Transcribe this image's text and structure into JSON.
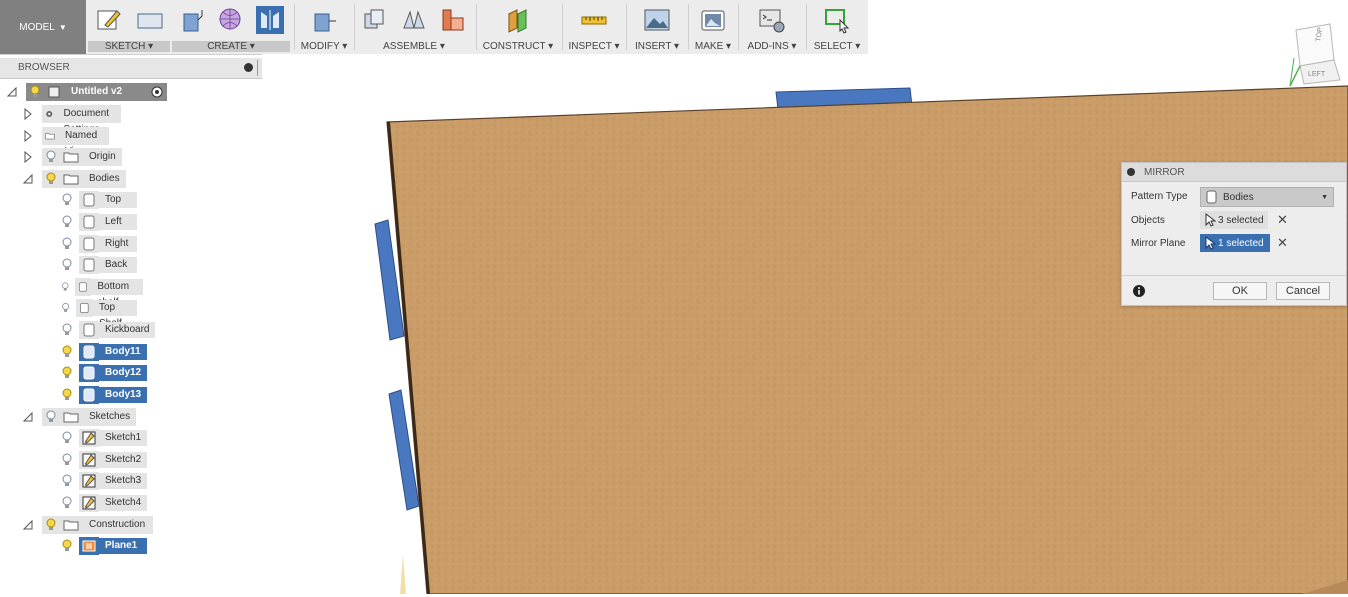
{
  "toolbar": {
    "model_label": "MODEL",
    "groups": {
      "sketch": "SKETCH ▾",
      "create": "CREATE ▾",
      "modify": "MODIFY ▾",
      "assemble": "ASSEMBLE ▾",
      "construct": "CONSTRUCT ▾",
      "inspect": "INSPECT ▾",
      "insert": "INSERT ▾",
      "make": "MAKE ▾",
      "addins": "ADD-INS ▾",
      "select": "SELECT ▾"
    }
  },
  "browser": {
    "title": "BROWSER",
    "root": "Untitled v2",
    "document_settings": "Document Settings",
    "named_views": "Named Views",
    "origin": "Origin",
    "bodies": "Bodies",
    "body_items": [
      "Top",
      "Left",
      "Right",
      "Back",
      "Bottom shelf",
      "Top Shelf",
      "Kickboard",
      "Body11",
      "Body12",
      "Body13"
    ],
    "sketches": "Sketches",
    "sketch_items": [
      "Sketch1",
      "Sketch2",
      "Sketch3",
      "Sketch4"
    ],
    "construction": "Construction",
    "plane": "Plane1"
  },
  "mirror": {
    "title": "MIRROR",
    "pattern_type_label": "Pattern Type",
    "pattern_type_value": "Bodies",
    "objects_label": "Objects",
    "objects_value": "3 selected",
    "mirror_plane_label": "Mirror Plane",
    "mirror_plane_value": "1 selected",
    "ok": "OK",
    "cancel": "Cancel"
  },
  "viewcube": {
    "top": "TOP",
    "left": "LEFT"
  },
  "colors": {
    "selection_blue": "#3a6fb0",
    "board": "#c79a66",
    "part_blue": "#4a78c0"
  }
}
